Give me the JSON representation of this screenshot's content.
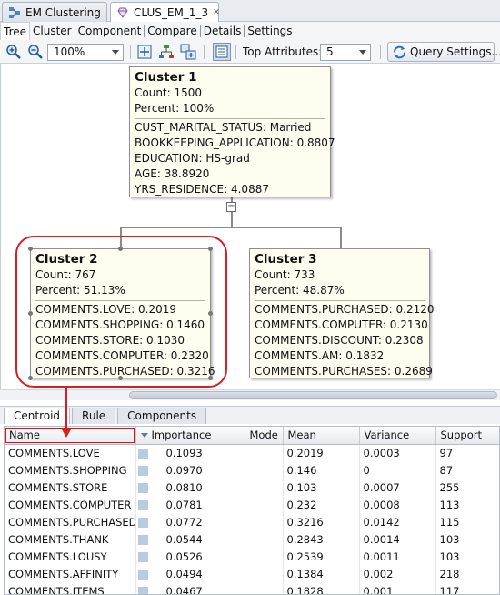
{
  "doc_tabs": [
    {
      "label": "EM Clustering"
    },
    {
      "label": "CLUS_EM_1_3"
    }
  ],
  "view_tabs": [
    "Tree",
    "Cluster",
    "Component",
    "Compare",
    "Details",
    "Settings"
  ],
  "toolbar": {
    "zoom_value": "100%",
    "top_attributes_label": "Top Attributes:",
    "top_attributes_value": "5",
    "query_settings_label": "Query Settings..."
  },
  "clusters": [
    {
      "title": "Cluster 1",
      "count": "Count: 1500",
      "percent": "Percent: 100%",
      "attributes": [
        "CUST_MARITAL_STATUS: Married",
        "BOOKKEEPING_APPLICATION: 0.8807",
        "EDUCATION: HS-grad",
        "AGE: 38.8920",
        "YRS_RESIDENCE: 4.0887"
      ]
    },
    {
      "title": "Cluster 2",
      "count": "Count: 767",
      "percent": "Percent: 51.13%",
      "attributes": [
        "COMMENTS.LOVE: 0.2019",
        "COMMENTS.SHOPPING: 0.1460",
        "COMMENTS.STORE: 0.1030",
        "COMMENTS.COMPUTER: 0.2320",
        "COMMENTS.PURCHASED: 0.3216"
      ]
    },
    {
      "title": "Cluster 3",
      "count": "Count: 733",
      "percent": "Percent: 48.87%",
      "attributes": [
        "COMMENTS.PURCHASED: 0.2120",
        "COMMENTS.COMPUTER: 0.2130",
        "COMMENTS.DISCOUNT: 0.2308",
        "COMMENTS.AM: 0.1832",
        "COMMENTS.PURCHASES: 0.2689"
      ]
    }
  ],
  "lower_tabs": [
    "Centroid",
    "Rule",
    "Components"
  ],
  "grid": {
    "headers": [
      "Name",
      "Importance",
      "Mode",
      "Mean",
      "Variance",
      "Support"
    ],
    "rows": [
      [
        "COMMENTS.LOVE",
        "0.1093",
        "",
        "0.2019",
        "0.0003",
        "97"
      ],
      [
        "COMMENTS.SHOPPING",
        "0.0970",
        "",
        "0.146",
        "0",
        "87"
      ],
      [
        "COMMENTS.STORE",
        "0.0810",
        "",
        "0.103",
        "0.0007",
        "255"
      ],
      [
        "COMMENTS.COMPUTER",
        "0.0781",
        "",
        "0.232",
        "0.0008",
        "113"
      ],
      [
        "COMMENTS.PURCHASED",
        "0.0772",
        "",
        "0.3216",
        "0.0142",
        "115"
      ],
      [
        "COMMENTS.THANK",
        "0.0544",
        "",
        "0.2843",
        "0.0014",
        "103"
      ],
      [
        "COMMENTS.LOUSY",
        "0.0526",
        "",
        "0.2539",
        "0.0011",
        "103"
      ],
      [
        "COMMENTS.AFFINITY",
        "0.0494",
        "",
        "0.1384",
        "0.002",
        "218"
      ],
      [
        "COMMENTS.ITEMS",
        "0.0467",
        "",
        "0.1828",
        "0.001",
        "117"
      ]
    ]
  },
  "colors": {
    "node_fill": "#fefdf0",
    "annotation_red": "#d42020",
    "importance_bar": "#b8cbe1"
  }
}
